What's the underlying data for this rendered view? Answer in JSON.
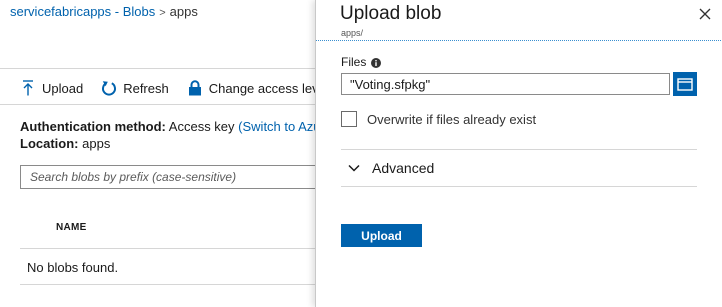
{
  "breadcrumb": {
    "root": "servicefabricapps - Blobs",
    "separator": ">",
    "current": "apps"
  },
  "toolbar": {
    "upload_label": "Upload",
    "refresh_label": "Refresh",
    "access_label": "Change access level"
  },
  "details": {
    "auth_label": "Authentication method:",
    "auth_value": "Access key",
    "auth_link": "(Switch to Azure AD User Account)",
    "location_label": "Location:",
    "location_value": "apps"
  },
  "search": {
    "placeholder": "Search blobs by prefix (case-sensitive)"
  },
  "table": {
    "columns": [
      "NAME"
    ],
    "empty_text": "No blobs found."
  },
  "panel": {
    "title": "Upload blob",
    "subtitle": "apps/",
    "files_label": "Files",
    "file_value": "\"Voting.sfpkg\"",
    "overwrite_label": "Overwrite if files already exist",
    "overwrite_checked": false,
    "advanced_label": "Advanced",
    "upload_button": "Upload"
  },
  "icons": {
    "upload": "upload-arrow-icon",
    "refresh": "refresh-icon",
    "access": "lock-icon",
    "close": "close-icon",
    "info": "info-icon",
    "browse": "folder-icon",
    "advanced": "chevron-down-icon"
  },
  "colors": {
    "accent": "#0062ad",
    "link": "#0062ad",
    "border": "#8a8a8a",
    "divider": "#d6d6d6"
  }
}
